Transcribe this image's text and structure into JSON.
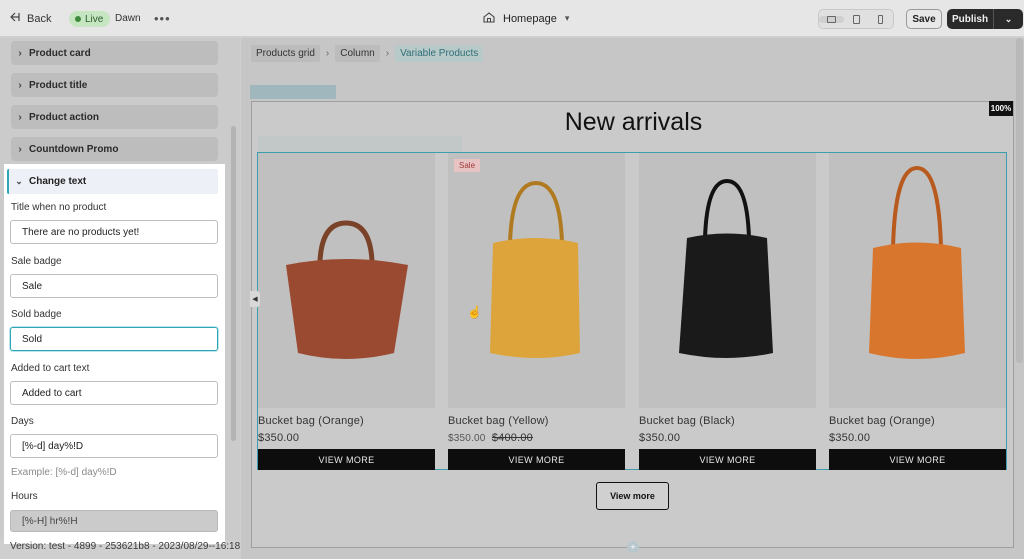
{
  "topbar": {
    "back_label": "Back",
    "live_label": "Live",
    "theme_name": "Dawn",
    "more_glyph": "•••",
    "page_selector": "Homepage",
    "devices": [
      "desktop-icon",
      "tablet-icon",
      "mobile-icon"
    ],
    "save_label": "Save",
    "publish_label": "Publish"
  },
  "sidebar": {
    "collapsed_sections": [
      "Product card",
      "Product title",
      "Product action",
      "Countdown Promo"
    ],
    "open_section": "Change text",
    "fields": [
      {
        "label": "Title when no product",
        "value": "There are no products yet!"
      },
      {
        "label": "Sale badge",
        "value": "Sale"
      },
      {
        "label": "Sold badge",
        "value": "Sold"
      },
      {
        "label": "Added to cart text",
        "value": "Added to cart"
      },
      {
        "label": "Days",
        "value": "[%-d] day%!D"
      }
    ],
    "days_hint": "Example: [%-d] day%!D",
    "hours_label": "Hours",
    "hours_value": "[%-H] hr%!H"
  },
  "footer": {
    "version": "Version: test - 4899 - 253621b8 - 2023/08/29--16:18"
  },
  "preview": {
    "breadcrumbs": [
      "Products grid",
      "Column",
      "Variable Products"
    ],
    "zoom": "100%",
    "heading": "New arrivals",
    "products": [
      {
        "title": "Bucket bag (Orange)",
        "price": "$350.00",
        "compare_price": "",
        "button": "VIEW MORE",
        "badge": "",
        "bag_color": "#9a4a30"
      },
      {
        "title": "Bucket bag (Yellow)",
        "price": "$350.00",
        "compare_price": "$400.00",
        "button": "VIEW MORE",
        "badge": "Sale",
        "bag_color": "#dca43a"
      },
      {
        "title": "Bucket bag (Black)",
        "price": "$350.00",
        "compare_price": "",
        "button": "VIEW MORE",
        "badge": "",
        "bag_color": "#1a1a1a"
      },
      {
        "title": "Bucket bag (Orange)",
        "price": "$350.00",
        "compare_price": "",
        "button": "VIEW MORE",
        "badge": "",
        "bag_color": "#d9762e"
      }
    ],
    "view_more_label": "View more"
  },
  "colors": {
    "accent": "#2fa6b7",
    "live_badge": "#c6e6c2",
    "button_dark": "#0d0d0d"
  }
}
